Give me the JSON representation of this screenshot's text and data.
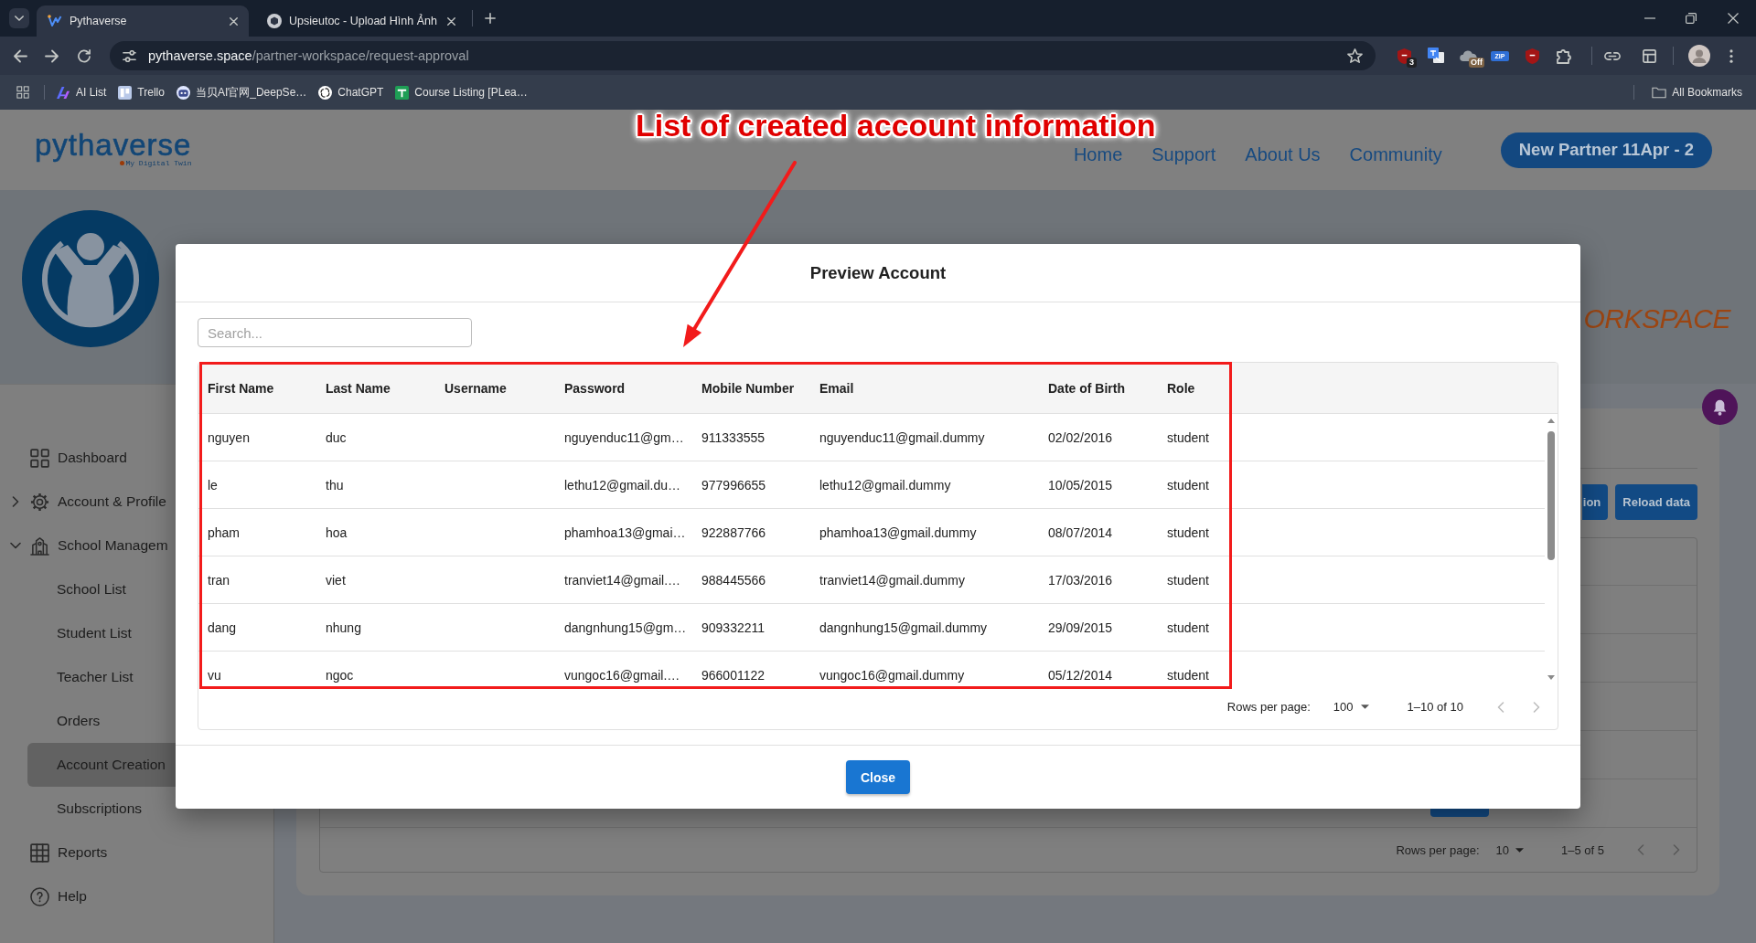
{
  "browser": {
    "tabs": [
      {
        "title": "Pythaverse",
        "selected": true
      },
      {
        "title": "Upsieutoc - Upload Hình Ảnh",
        "selected": false
      }
    ],
    "address": {
      "host": "pythaverse.space",
      "path": "/partner-workspace/request-approval"
    },
    "extensions": [
      {
        "kind": "shield",
        "badge": "3"
      },
      {
        "kind": "translate"
      },
      {
        "kind": "cloud",
        "badge": "Off"
      },
      {
        "kind": "zip",
        "label": "ZIP"
      },
      {
        "kind": "shield"
      },
      {
        "kind": "puzzle"
      }
    ],
    "bookmarks": [
      {
        "label": "AI List"
      },
      {
        "label": "Trello"
      },
      {
        "label": "当贝AI官网_DeepSe…"
      },
      {
        "label": "ChatGPT"
      },
      {
        "label": "Course Listing [PLea…"
      }
    ],
    "all_bookmarks": "All Bookmarks"
  },
  "annotation": {
    "text": "List of created account information"
  },
  "site": {
    "logo": {
      "name": "pythaverse",
      "tagline": "My Digital Twin"
    },
    "nav": [
      "Home",
      "Support",
      "About Us",
      "Community"
    ],
    "account_button": "New Partner 11Apr - 2"
  },
  "banner": {
    "title": "ORKSPACE"
  },
  "sidebar": {
    "items": [
      {
        "label": "Dashboard",
        "kind": "link",
        "selected": false
      },
      {
        "label": "Account & Profile",
        "kind": "group",
        "expanded": false,
        "selected": false
      },
      {
        "label": "School Managem",
        "kind": "group",
        "expanded": true,
        "selected": false,
        "children": [
          {
            "label": "School List",
            "selected": false
          },
          {
            "label": "Student List",
            "selected": false
          },
          {
            "label": "Teacher List",
            "selected": false
          },
          {
            "label": "Orders",
            "selected": false
          },
          {
            "label": "Account Creation",
            "selected": true
          },
          {
            "label": "Subscriptions",
            "selected": false
          }
        ]
      },
      {
        "label": "Reports",
        "kind": "link",
        "selected": false
      },
      {
        "label": "Help",
        "kind": "link",
        "selected": false
      }
    ]
  },
  "content": {
    "actions": [
      "ion",
      "Reload data"
    ],
    "pagination": {
      "rows_per_page_label": "Rows per page:",
      "rows_per_page": "10",
      "range": "1–5 of 5",
      "previous_disabled": true,
      "next_disabled": true
    }
  },
  "modal": {
    "title": "Preview Account",
    "search": {
      "placeholder": "Search..."
    },
    "columns": [
      "First Name",
      "Last Name",
      "Username",
      "Password",
      "Mobile Number",
      "Email",
      "Date of Birth",
      "Role"
    ],
    "rows": [
      {
        "first_name": "nguyen",
        "last_name": "duc",
        "password": "nguyenduc11@gm…",
        "mobile_number": "911333555",
        "email": "nguyenduc11@gmail.dummy",
        "date_of_birth": "02/02/2016",
        "role": "student"
      },
      {
        "first_name": "le",
        "last_name": "thu",
        "password": "lethu12@gmail.du…",
        "mobile_number": "977996655",
        "email": "lethu12@gmail.dummy",
        "date_of_birth": "10/05/2015",
        "role": "student"
      },
      {
        "first_name": "pham",
        "last_name": "hoa",
        "password": "phamhoa13@gmai…",
        "mobile_number": "922887766",
        "email": "phamhoa13@gmail.dummy",
        "date_of_birth": "08/07/2014",
        "role": "student"
      },
      {
        "first_name": "tran",
        "last_name": "viet",
        "password": "tranviet14@gmail.…",
        "mobile_number": "988445566",
        "email": "tranviet14@gmail.dummy",
        "date_of_birth": "17/03/2016",
        "role": "student"
      },
      {
        "first_name": "dang",
        "last_name": "nhung",
        "password": "dangnhung15@gm…",
        "mobile_number": "909332211",
        "email": "dangnhung15@gmail.dummy",
        "date_of_birth": "29/09/2015",
        "role": "student"
      },
      {
        "first_name": "vu",
        "last_name": "ngoc",
        "password": "vungoc16@gmail.…",
        "mobile_number": "966001122",
        "email": "vungoc16@gmail.dummy",
        "date_of_birth": "05/12/2014",
        "role": "student"
      }
    ],
    "pagination": {
      "rows_per_page_label": "Rows per page:",
      "rows_per_page": "100",
      "range": "1–10 of 10",
      "previous_disabled": true,
      "next_disabled": true
    },
    "close_button": "Close"
  }
}
